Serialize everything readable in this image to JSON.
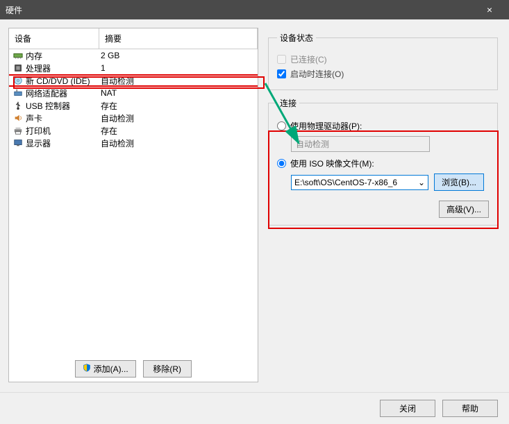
{
  "titlebar": {
    "title": "硬件",
    "close": "×"
  },
  "table": {
    "headers": {
      "device": "设备",
      "summary": "摘要"
    },
    "rows": [
      {
        "icon": "memory-icon",
        "device": "内存",
        "summary": "2 GB"
      },
      {
        "icon": "cpu-icon",
        "device": "处理器",
        "summary": "1"
      },
      {
        "icon": "disc-icon",
        "device": "新 CD/DVD (IDE)",
        "summary": "自动检测",
        "selected": true
      },
      {
        "icon": "network-icon",
        "device": "网络适配器",
        "summary": "NAT"
      },
      {
        "icon": "usb-icon",
        "device": "USB 控制器",
        "summary": "存在"
      },
      {
        "icon": "sound-icon",
        "device": "声卡",
        "summary": "自动检测"
      },
      {
        "icon": "printer-icon",
        "device": "打印机",
        "summary": "存在"
      },
      {
        "icon": "display-icon",
        "device": "显示器",
        "summary": "自动检测"
      }
    ]
  },
  "status": {
    "legend": "设备状态",
    "connected": "已连接(C)",
    "connect_on_start": "启动时连接(O)"
  },
  "connection": {
    "legend": "连接",
    "physical": "使用物理驱动器(P):",
    "auto_detect": "自动检测",
    "iso_label": "使用 ISO 映像文件(M):",
    "iso_path": "E:\\soft\\OS\\CentOS-7-x86_6",
    "browse": "浏览(B)...",
    "advanced": "高级(V)..."
  },
  "buttons": {
    "add": "添加(A)...",
    "remove": "移除(R)",
    "close": "关闭",
    "help": "帮助"
  },
  "colors": {
    "accent": "#0078d7",
    "highlight": "#e00000"
  }
}
